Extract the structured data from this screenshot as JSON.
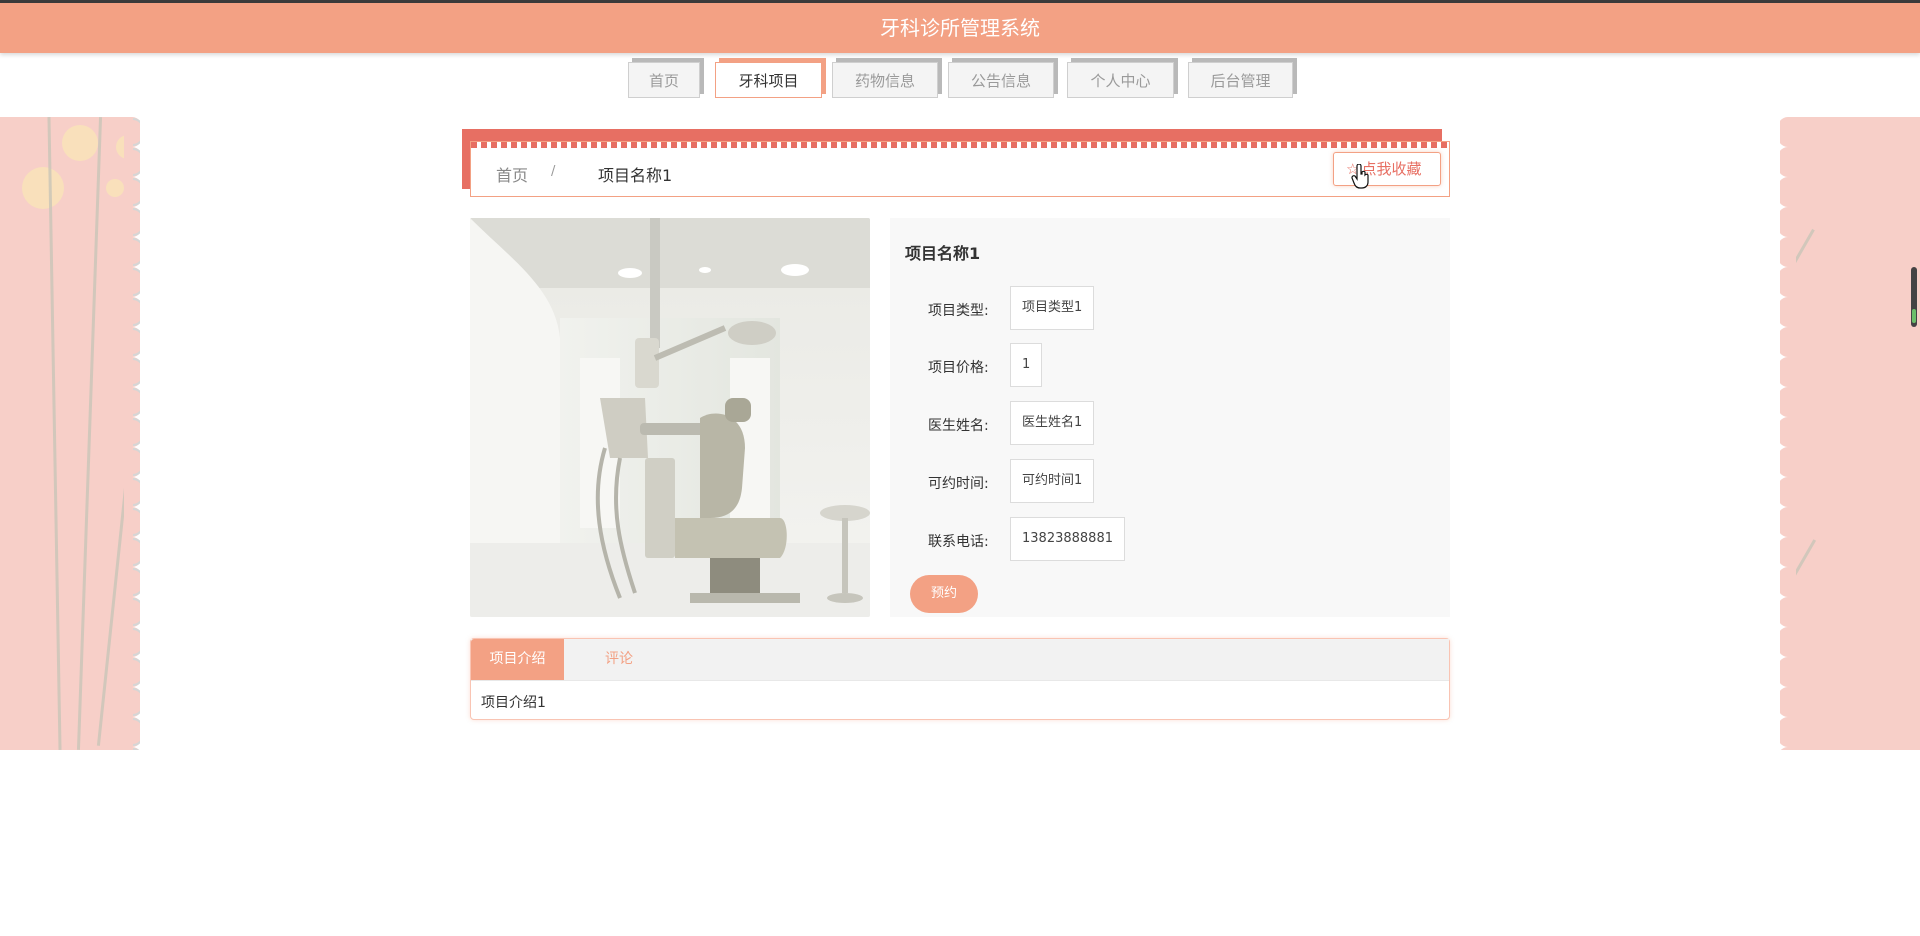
{
  "header": {
    "title": "牙科诊所管理系统"
  },
  "nav": {
    "items": [
      {
        "label": "首页",
        "active": false
      },
      {
        "label": "牙科项目",
        "active": true
      },
      {
        "label": "药物信息",
        "active": false
      },
      {
        "label": "公告信息",
        "active": false
      },
      {
        "label": "个人中心",
        "active": false
      },
      {
        "label": "后台管理",
        "active": false
      }
    ]
  },
  "breadcrumb": {
    "home": "首页",
    "separator": "/",
    "current": "项目名称1"
  },
  "favorite_button": {
    "label": "点我收藏",
    "icon": "star-icon"
  },
  "detail": {
    "title": "项目名称1",
    "fields": [
      {
        "label": "项目类型:",
        "value": "项目类型1"
      },
      {
        "label": "项目价格:",
        "value": "1"
      },
      {
        "label": "医生姓名:",
        "value": "医生姓名1"
      },
      {
        "label": "可约时间:",
        "value": "可约时间1"
      },
      {
        "label": "联系电话:",
        "value": "13823888881"
      }
    ],
    "book_button": "预约"
  },
  "tabs": {
    "items": [
      {
        "label": "项目介绍",
        "active": true
      },
      {
        "label": "评论",
        "active": false
      }
    ],
    "content": "项目介绍1"
  },
  "colors": {
    "primary": "#f3a184",
    "accent": "#e76f63",
    "side_pink": "#f7cfc8"
  }
}
